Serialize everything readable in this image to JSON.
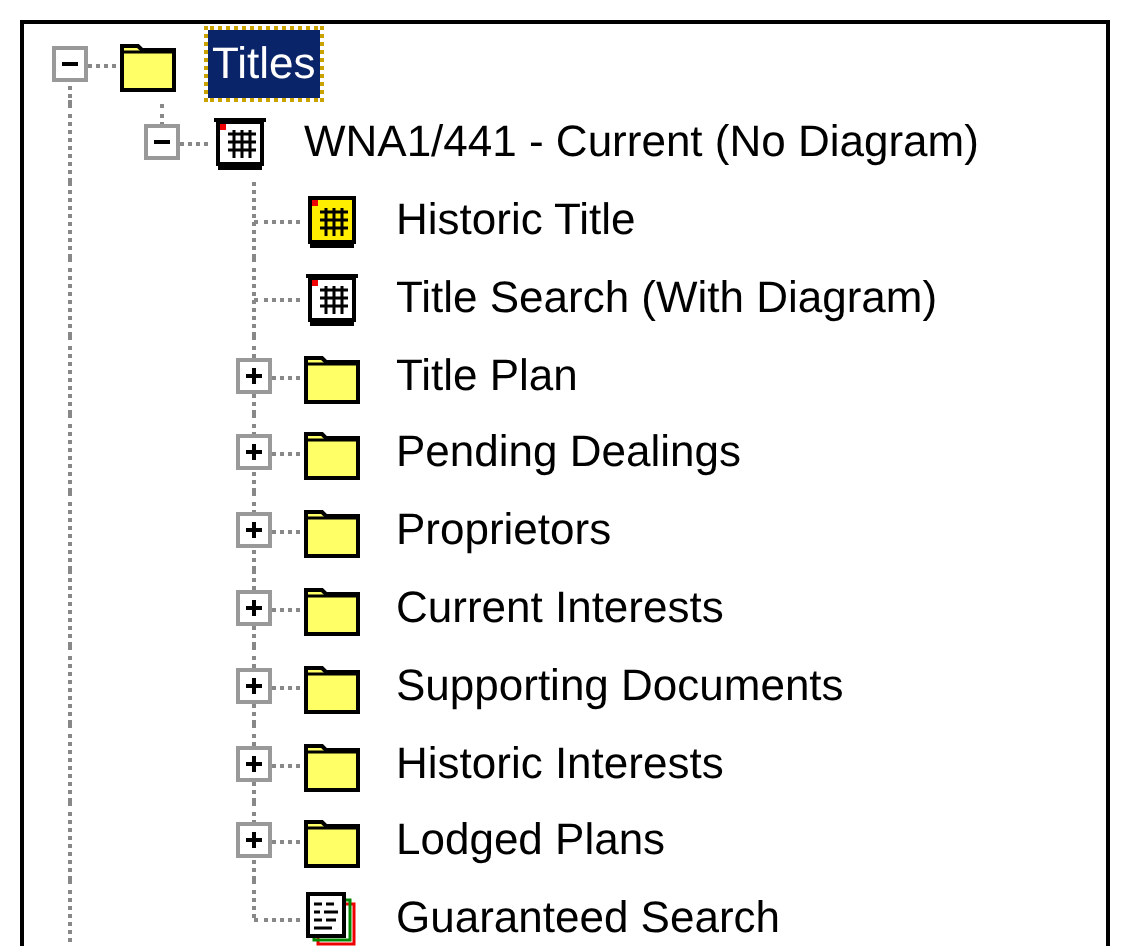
{
  "tree": [
    {
      "label": "Titles",
      "kind": "folder",
      "expanded": true,
      "selected": true,
      "children": [
        {
          "label": "WNA1/441 - Current (No Diagram)",
          "kind": "title",
          "expanded": true,
          "selected": false,
          "children": [
            {
              "label": "Historic Title",
              "kind": "historic-title",
              "selected": false
            },
            {
              "label": "Title Search (With Diagram)",
              "kind": "title",
              "selected": false
            },
            {
              "label": "Title Plan",
              "kind": "folder",
              "expanded": false,
              "selected": false
            },
            {
              "label": "Pending Dealings",
              "kind": "folder",
              "expanded": false,
              "selected": false
            },
            {
              "label": "Proprietors",
              "kind": "folder",
              "expanded": false,
              "selected": false
            },
            {
              "label": "Current Interests",
              "kind": "folder",
              "expanded": false,
              "selected": false
            },
            {
              "label": "Supporting Documents",
              "kind": "folder",
              "expanded": false,
              "selected": false
            },
            {
              "label": "Historic Interests",
              "kind": "folder",
              "expanded": false,
              "selected": false
            },
            {
              "label": "Lodged Plans",
              "kind": "folder",
              "expanded": false,
              "selected": false
            },
            {
              "label": "Guaranteed Search",
              "kind": "report",
              "selected": false
            }
          ]
        }
      ]
    }
  ]
}
